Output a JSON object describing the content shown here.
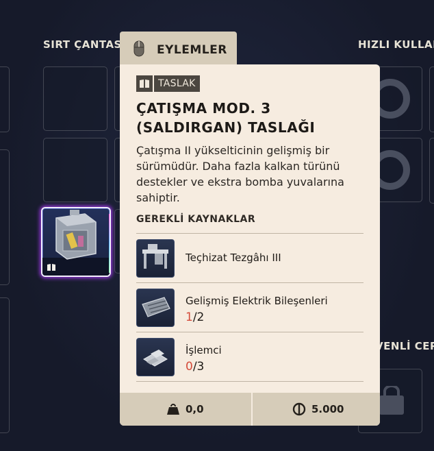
{
  "sections": {
    "backpack_label": "SIRT ÇANTASI",
    "quick_use_label": "HIZLI KULLAN",
    "safe_pocket_label": "VENLİ CEP"
  },
  "popup": {
    "tab_label": "EYLEMLER",
    "tag_label": "TASLAK",
    "title": "ÇATIŞMA MOD. 3 (SALDIRGAN) TASLAĞI",
    "description": "Çatışma II yükselticinin gelişmiş bir sürümüdür. Daha fazla kalkan türünü destekler ve ekstra bomba yuvalarına sahiptir.",
    "requirements_title": "GEREKLİ KAYNAKLAR",
    "resources": [
      {
        "name": "Teçhizat Tezgâhı III",
        "have": "",
        "need": ""
      },
      {
        "name": "Gelişmiş Elektrik Bileşenleri",
        "have": "1",
        "need": "/2"
      },
      {
        "name": "İşlemci",
        "have": "0",
        "need": "/3"
      }
    ],
    "footer": {
      "weight": "0,0",
      "price": "5.000"
    }
  },
  "colors": {
    "popup_bg": "#f6ece0",
    "tab_bg": "#d6ccb9",
    "missing_count": "#d44b3a",
    "page_bg": "#161a2a"
  },
  "icons": [
    "mouse-icon",
    "blueprint-icon",
    "weight-icon",
    "coin-icon",
    "lock-icon"
  ]
}
